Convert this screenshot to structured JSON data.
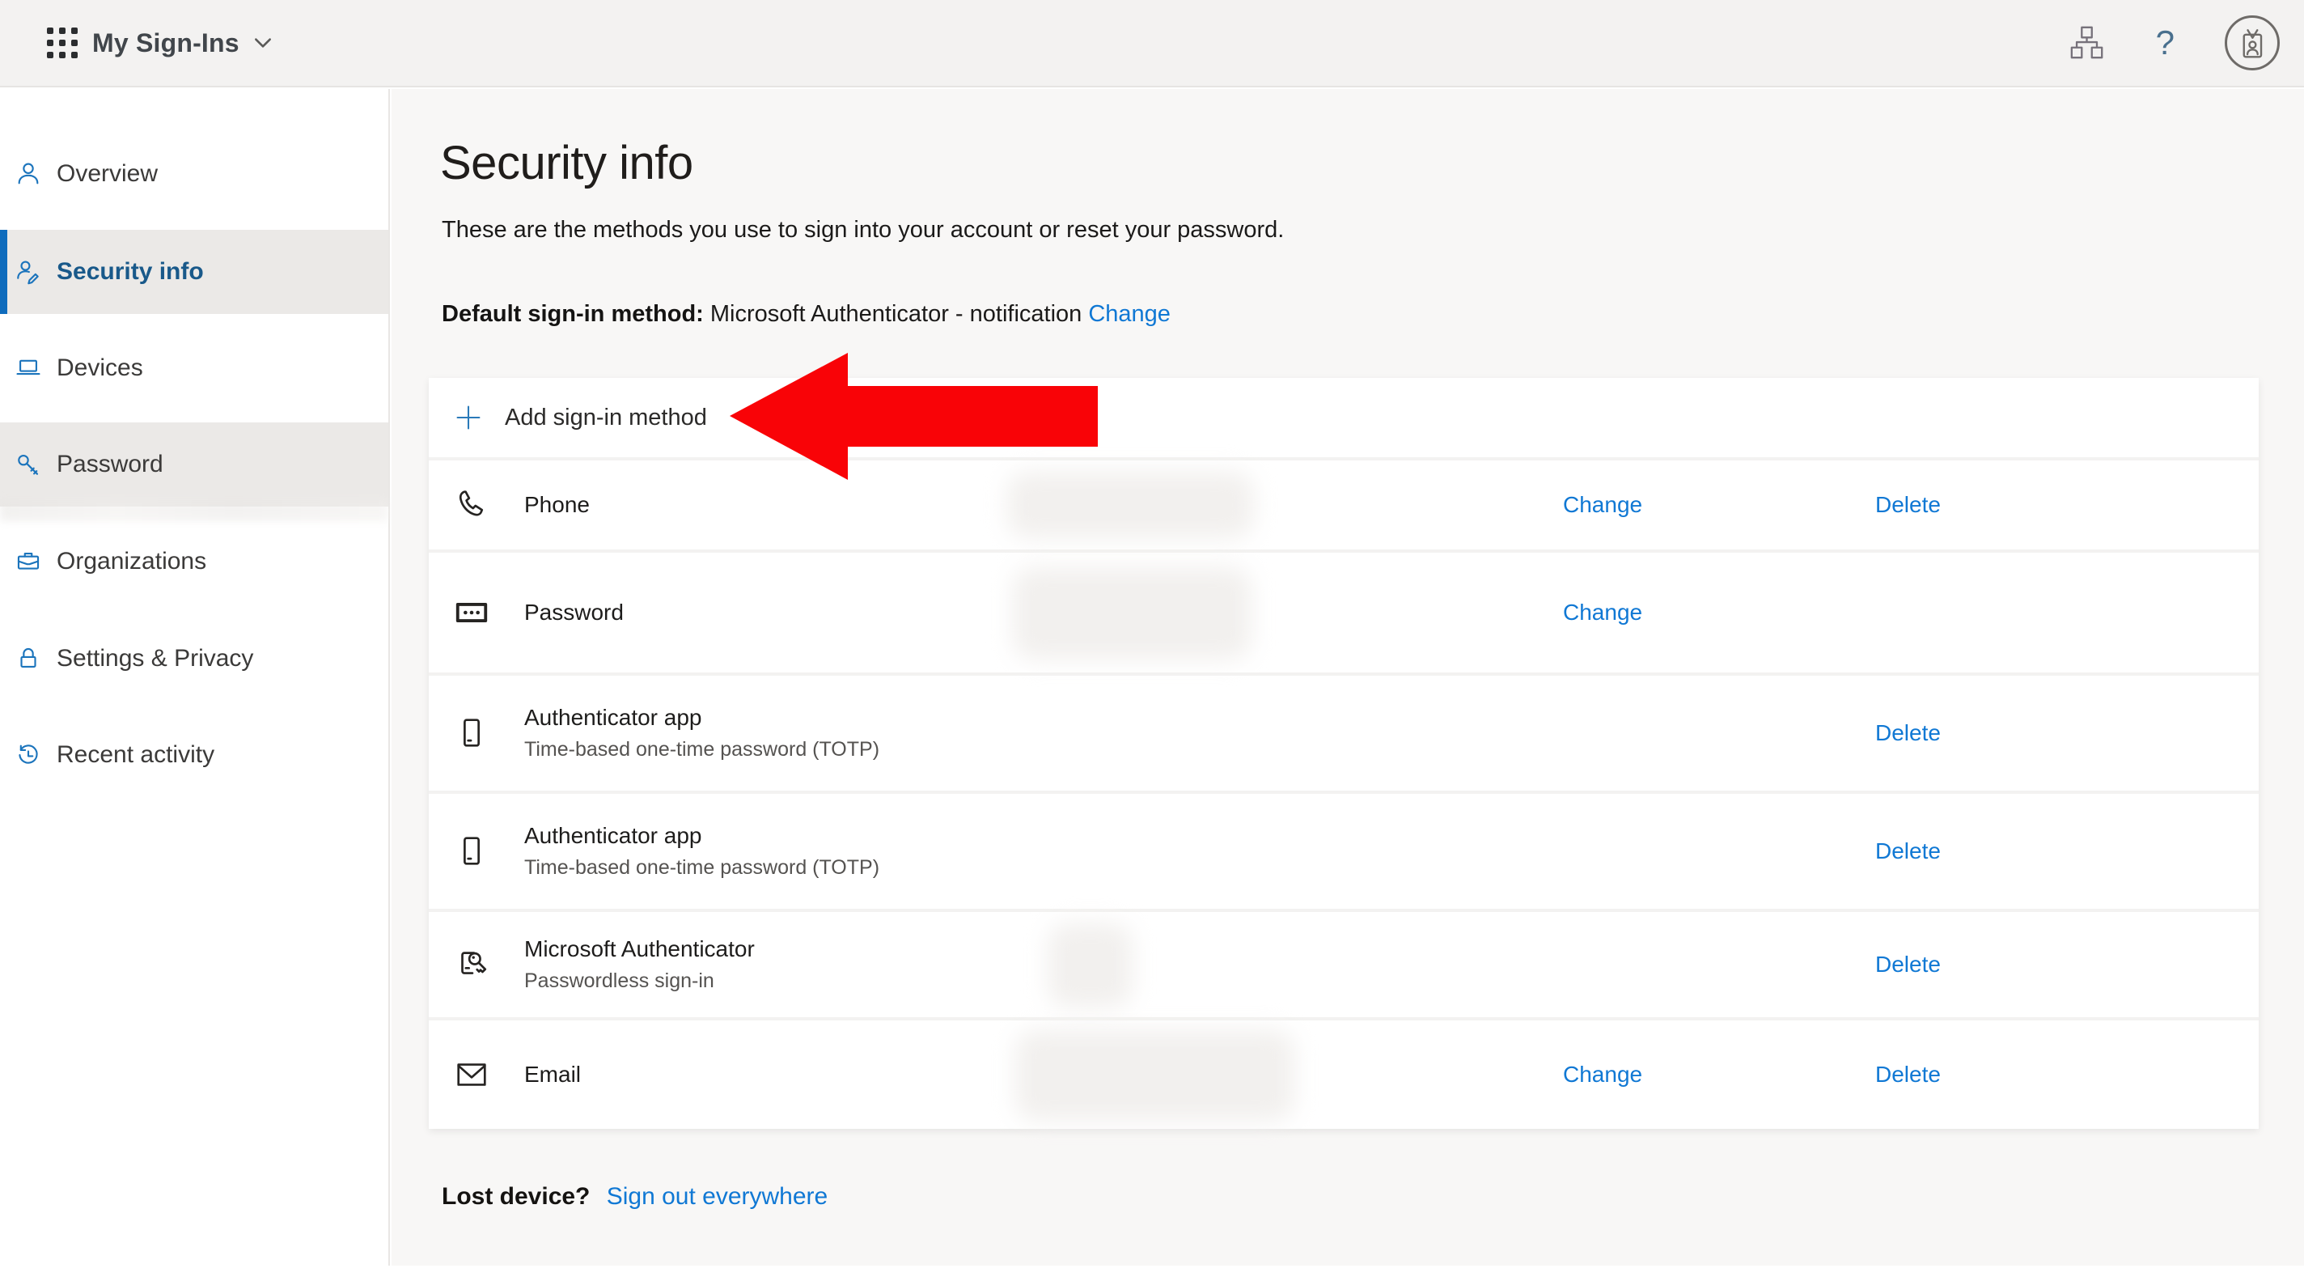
{
  "topbar": {
    "app_title": "My Sign-Ins",
    "help_glyph": "?"
  },
  "sidebar": {
    "items": [
      {
        "id": "overview",
        "label": "Overview",
        "icon": "person",
        "state": "normal"
      },
      {
        "id": "security-info",
        "label": "Security info",
        "icon": "person-edit",
        "state": "selected"
      },
      {
        "id": "devices",
        "label": "Devices",
        "icon": "laptop",
        "state": "normal"
      },
      {
        "id": "password",
        "label": "Password",
        "icon": "key",
        "state": "hover"
      },
      {
        "id": "organizations",
        "label": "Organizations",
        "icon": "briefcase",
        "state": "normal"
      },
      {
        "id": "settings-privacy",
        "label": "Settings & Privacy",
        "icon": "lock",
        "state": "normal"
      },
      {
        "id": "recent-activity",
        "label": "Recent activity",
        "icon": "history",
        "state": "normal"
      }
    ]
  },
  "main": {
    "title": "Security info",
    "description": "These are the methods you use to sign into your account or reset your password.",
    "default_method": {
      "label": "Default sign-in method:",
      "value": "Microsoft Authenticator - notification",
      "change_label": "Change"
    },
    "add_method_label": "Add sign-in method",
    "methods": [
      {
        "icon": "phone",
        "title": "Phone",
        "subtitle": "",
        "actions": [
          "Change",
          "Delete"
        ],
        "redacted": true
      },
      {
        "icon": "password",
        "title": "Password",
        "subtitle": "",
        "actions": [
          "Change"
        ],
        "redacted": true
      },
      {
        "icon": "mobile-app",
        "title": "Authenticator app",
        "subtitle": "Time-based one-time password (TOTP)",
        "actions": [
          "Delete"
        ],
        "redacted": false
      },
      {
        "icon": "mobile-app",
        "title": "Authenticator app",
        "subtitle": "Time-based one-time password (TOTP)",
        "actions": [
          "Delete"
        ],
        "redacted": false
      },
      {
        "icon": "ms-authenticator",
        "title": "Microsoft Authenticator",
        "subtitle": "Passwordless sign-in",
        "actions": [
          "Delete"
        ],
        "redacted": true
      },
      {
        "icon": "email",
        "title": "Email",
        "subtitle": "",
        "actions": [
          "Change",
          "Delete"
        ],
        "redacted": true
      }
    ],
    "lost_device": {
      "label": "Lost device?",
      "link": "Sign out everywhere"
    }
  },
  "colors": {
    "accent": "#0f6cbd",
    "link": "#1078d4",
    "arrow": "#f90307",
    "selected_nav_bg": "#ebe9e7"
  }
}
